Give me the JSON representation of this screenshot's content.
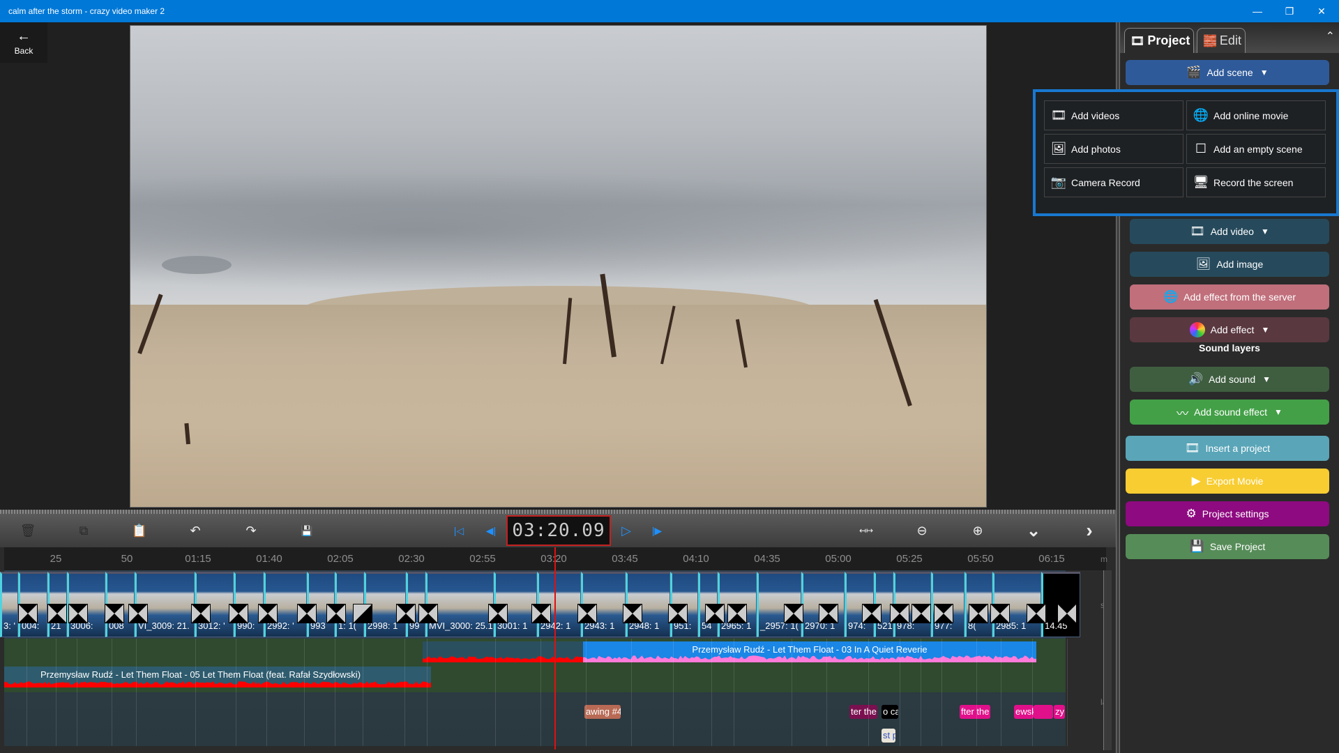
{
  "window": {
    "title": "calm after the storm - crazy video maker 2",
    "controls": {
      "minimize": "—",
      "restore": "❐",
      "close": "✕"
    }
  },
  "back": {
    "icon": "←",
    "label": "Back"
  },
  "toolbar": {
    "delete_icon": "🗑",
    "copy_icon": "⧉",
    "paste_icon": "📋",
    "undo_icon": "↶",
    "redo_icon": "↷",
    "save_frame_icon": "💾",
    "go_start_icon": "|◁",
    "prev_frame_icon": "◀|",
    "play_icon": "▷",
    "next_frame_icon": "|▶",
    "timecode": "03:20.09",
    "fit_icon": "↤↦",
    "zoom_out_icon": "⊖",
    "zoom_in_icon": "⊕",
    "expand_icon": "⌄",
    "next_icon": "›"
  },
  "timeline": {
    "ruler_ticks": [
      "25",
      "50",
      "01:15",
      "01:40",
      "02:05",
      "02:30",
      "02:55",
      "03:20",
      "03:45",
      "04:10",
      "04:35",
      "05:00",
      "05:25",
      "05:50",
      "06:15"
    ],
    "track_side_labels": [
      "m",
      "so",
      "la"
    ],
    "video_clips": [
      {
        "label": "3: '"
      },
      {
        "label": "004:"
      },
      {
        "label": "21"
      },
      {
        "label": "3006:"
      },
      {
        "label": "008"
      },
      {
        "label": "VI_3009: 21."
      },
      {
        "label": "3012: '"
      },
      {
        "label": "990:"
      },
      {
        "label": "2992: '"
      },
      {
        "label": "993"
      },
      {
        "label": "1: 1("
      },
      {
        "label": "2998: 1"
      },
      {
        "label": "99"
      },
      {
        "label": "MVI_3000: 25.1"
      },
      {
        "label": "3001: 1"
      },
      {
        "label": "2942: 1"
      },
      {
        "label": "2943: 1"
      },
      {
        "label": "2948: 1"
      },
      {
        "label": "951:"
      },
      {
        "label": "54"
      },
      {
        "label": "2965: 1"
      },
      {
        "label": "_2957: 1("
      },
      {
        "label": "2970: 1"
      },
      {
        "label": "974:"
      },
      {
        "label": "521"
      },
      {
        "label": "978:"
      },
      {
        "label": "977:"
      },
      {
        "label": "8("
      },
      {
        "label": "2985: 1"
      },
      {
        "label": "14.45"
      }
    ],
    "audio_clips": [
      {
        "label": "Przemysław Rudź - Let Them Float - 03 In A Quiet Reverie",
        "color": "#1a86e6",
        "wave_color": "#ff7ad9"
      },
      {
        "label": "Przemysław Rudź - Let Them Float - 05 Let Them Float (feat. Rafał Szydłowski)",
        "color": "#2e5b6e",
        "wave_color": "#ff0000"
      }
    ],
    "text_clips": [
      {
        "label": "awing #4",
        "color": "#b86a55"
      },
      {
        "label": "ter the",
        "color": "#7a1050"
      },
      {
        "label": "o ca",
        "color": "#000000"
      },
      {
        "label": "fter the",
        "color": "#e0108a"
      },
      {
        "label": "ewsk",
        "color": "#e0108a"
      },
      {
        "label": "",
        "color": "#e0108a"
      },
      {
        "label": "zy",
        "color": "#e0108a"
      },
      {
        "label": "st p",
        "color": "#e8e4d8"
      }
    ],
    "playhead_time": "03:20.09"
  },
  "panel": {
    "tabs": [
      {
        "label": "Project",
        "icon": "🎞",
        "active": true
      },
      {
        "label": "Edit",
        "icon": "🧱",
        "active": false
      }
    ],
    "collapse_icon": "⌃",
    "buttons": {
      "add_scene": {
        "label": "Add scene",
        "icon": "🎬",
        "color": "#2f5a99"
      },
      "add_video": {
        "label": "Add video",
        "icon": "🎞",
        "color": "#264a5c"
      },
      "add_image": {
        "label": "Add image",
        "icon": "🖼",
        "color": "#264a5c"
      },
      "add_effect_server": {
        "label": "Add effect from the server",
        "icon": "🌐",
        "color": "#c06f7b"
      },
      "add_effect": {
        "label": "Add effect",
        "icon": "✿",
        "color": "#5a3840"
      },
      "sound_layers": "Sound layers",
      "add_sound": {
        "label": "Add sound",
        "icon": "🔊",
        "color": "#3f5e40"
      },
      "add_sound_effect": {
        "label": "Add sound effect",
        "icon": "〰",
        "color": "#43a047"
      },
      "insert_project": {
        "label": "Insert a project",
        "icon": "🎞",
        "color": "#5aa5b8"
      },
      "export_movie": {
        "label": "Export Movie",
        "icon": "▶",
        "color": "#f8cd32"
      },
      "project_settings": {
        "label": "Project settings",
        "icon": "⚙",
        "color": "#8e0a80"
      },
      "save_project": {
        "label": "Save Project",
        "icon": "💾",
        "color": "#568c58"
      }
    }
  },
  "add_scene_menu": {
    "items": [
      {
        "label": "Add videos",
        "icon": "🎞"
      },
      {
        "label": "Add online movie",
        "icon": "🌐"
      },
      {
        "label": "Add photos",
        "icon": "🖼"
      },
      {
        "label": "Add an empty scene",
        "icon": "☐"
      },
      {
        "label": "Camera Record",
        "icon": "📷"
      },
      {
        "label": "Record the screen",
        "icon": "🖥"
      }
    ]
  }
}
